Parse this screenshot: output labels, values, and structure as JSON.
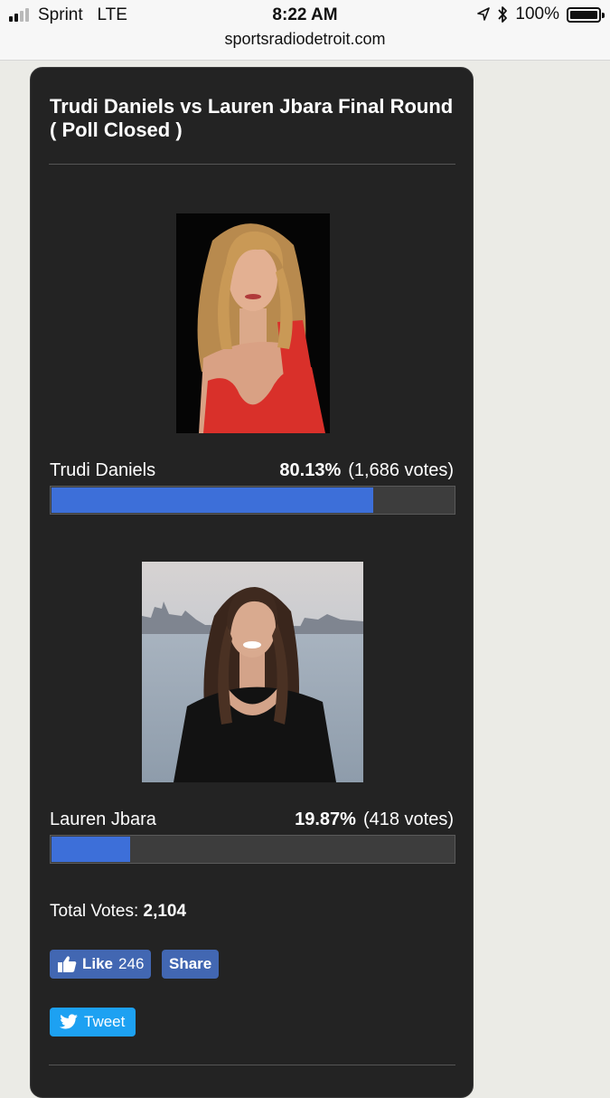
{
  "status_bar": {
    "carrier": "Sprint",
    "network": "LTE",
    "time": "8:22 AM",
    "battery_percent": "100%",
    "signal_bars": 4,
    "signal_bars_filled": 2,
    "url": "sportsradiodetroit.com"
  },
  "poll": {
    "title": "Trudi Daniels vs Lauren Jbara Final Round ( Poll Closed )",
    "options": [
      {
        "name": "Trudi Daniels",
        "percent": "80.13%",
        "votes": "(1,686 votes)",
        "fraction": 0.8013
      },
      {
        "name": "Lauren Jbara",
        "percent": "19.87%",
        "votes": "(418 votes)",
        "fraction": 0.1987
      }
    ],
    "total_label": "Total Votes:",
    "total_value": "2,104"
  },
  "social": {
    "like_label": "Like",
    "like_count": "246",
    "share_label": "Share",
    "tweet_label": "Tweet"
  },
  "colors": {
    "bar_fill": "#3d6fd9",
    "facebook": "#4267b2",
    "twitter": "#1da1f2",
    "card_background": "#232323"
  }
}
